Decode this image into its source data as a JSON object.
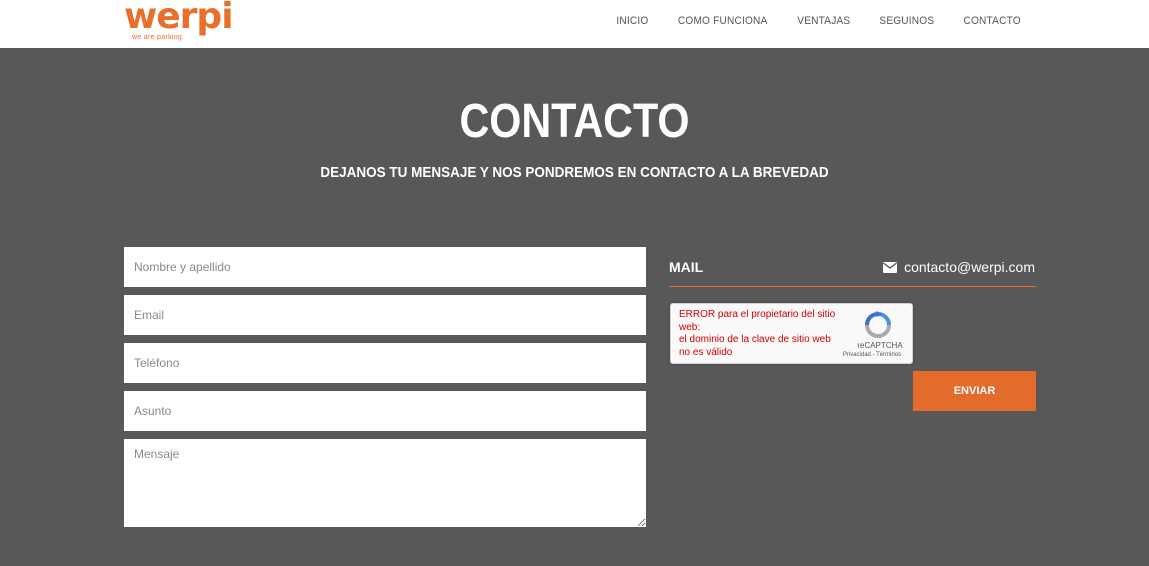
{
  "brand": {
    "name": "werpi",
    "tagline": "we are parking",
    "color": "#e8702a"
  },
  "nav": {
    "items": [
      {
        "label": "INICIO"
      },
      {
        "label": "COMO FUNCIONA"
      },
      {
        "label": "VENTAJAS"
      },
      {
        "label": "SEGUINOS"
      },
      {
        "label": "CONTACTO"
      }
    ]
  },
  "hero": {
    "title": "CONTACTO",
    "subtitle": "DEJANOS TU MENSAJE Y NOS PONDREMOS EN CONTACTO A LA BREVEDAD"
  },
  "form": {
    "name_placeholder": "Nombre y apellido",
    "email_placeholder": "Email",
    "phone_placeholder": "Teléfono",
    "subject_placeholder": "Asunto",
    "message_placeholder": "Mensaje",
    "submit_label": "ENVIAR"
  },
  "contact": {
    "mail_label": "MAIL",
    "mail_value": "contacto@werpi.com",
    "mail_icon": "envelope-icon"
  },
  "captcha": {
    "error_line1": "ERROR para el propietario del sitio web:",
    "error_line2": "el dominio de la clave de sitio web no es válido",
    "brand": "reCAPTCHA",
    "links": "Privacidad - Términos"
  },
  "colors": {
    "accent": "#e36c2d",
    "background": "#58585a",
    "header": "#ffffff",
    "error": "#d00000"
  }
}
